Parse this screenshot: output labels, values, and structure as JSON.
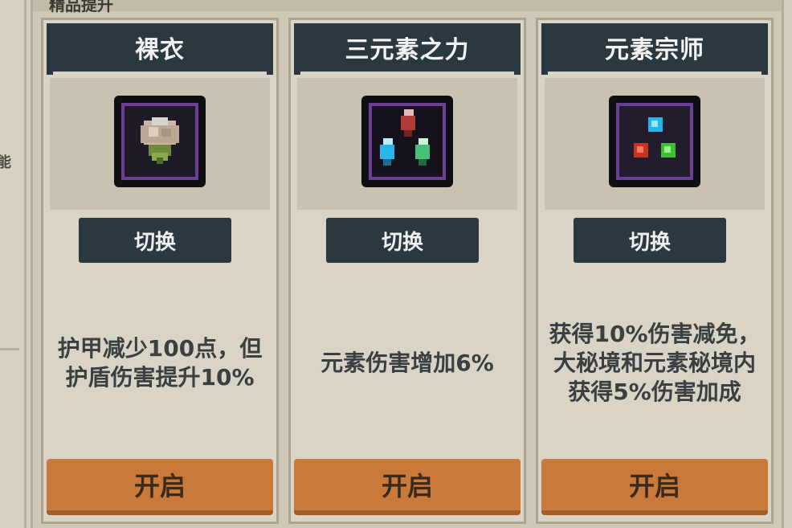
{
  "header": {
    "title_fragment": "精品提升"
  },
  "left_edge": {
    "glyph": "能"
  },
  "cards": [
    {
      "title": "裸衣",
      "icon": "flower-icon",
      "switch_label": "切换",
      "description": "护甲减少100点，但护盾伤害提升10%",
      "open_label": "开启"
    },
    {
      "title": "三元素之力",
      "icon": "three-crystals-icon",
      "switch_label": "切换",
      "description": "元素伤害增加6%",
      "open_label": "开启"
    },
    {
      "title": "元素宗师",
      "icon": "element-gems-icon",
      "switch_label": "切换",
      "description": "获得10%伤害减免，大秘境和元素秘境内获得5%伤害加成",
      "open_label": "开启"
    }
  ],
  "colors": {
    "title_bar": "#2b3840",
    "open_button": "#c9793a",
    "icon_border": "#6b3f96",
    "panel_bg": "#d9d4c5"
  }
}
